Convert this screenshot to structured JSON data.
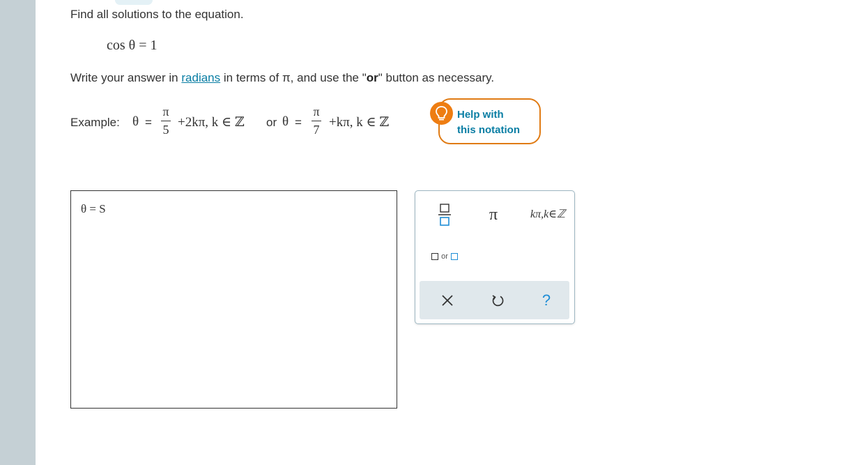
{
  "question": {
    "prompt": "Find all solutions to the equation.",
    "equation": "cos θ = 1",
    "instruction_prefix": "Write your answer in",
    "instruction_link": "radians",
    "instruction_middle": "in terms of π, and use the \"",
    "instruction_or": "or",
    "instruction_suffix": "\" button as necessary."
  },
  "example": {
    "label": "Example:",
    "theta": "θ",
    "eq": "=",
    "frac1_num": "π",
    "frac1_den": "5",
    "term1": "+2kπ, k ∈ ℤ",
    "or": "or",
    "frac2_num": "π",
    "frac2_den": "7",
    "term2": "+kπ, k ∈ ℤ"
  },
  "help": {
    "line1": "Help with",
    "line2": "this notation"
  },
  "answer": {
    "value": "θ =  S"
  },
  "keypad": {
    "pi": "π",
    "kpi": "kπ,k∈ℤ",
    "or_label": "or",
    "help": "?"
  },
  "colors": {
    "accent_orange": "#ee7d12",
    "link_blue": "#0a7ea4",
    "key_blue": "#1f8ed6",
    "left_strip": "#c5d0d5",
    "keypad_bar": "#e0e8ec"
  }
}
